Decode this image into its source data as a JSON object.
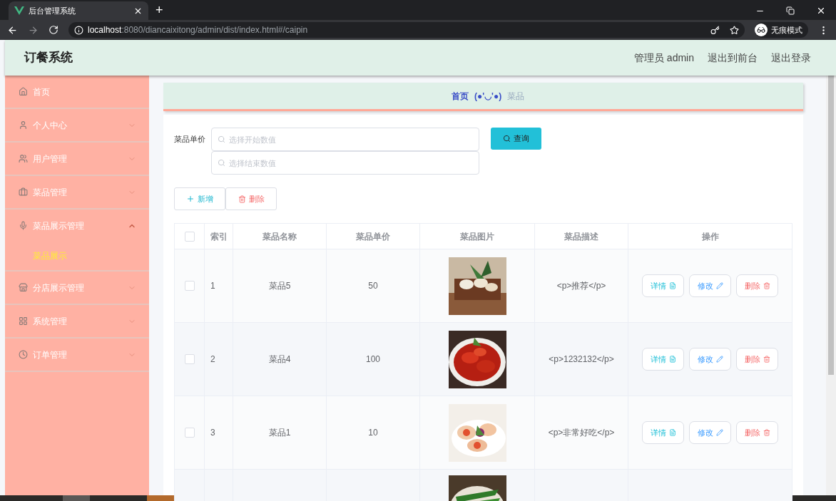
{
  "browser": {
    "tab_title": "后台管理系统",
    "new_tab": "+",
    "url_host": "localhost",
    "url_rest": ":8080/diancaixitong/admin/dist/index.html#/caipin",
    "profile": "无痕模式"
  },
  "header": {
    "title": "订餐系统",
    "links": [
      "管理员 admin",
      "退出到前台",
      "退出登录"
    ]
  },
  "sidebar": {
    "items": [
      {
        "label": "首页",
        "kind": "link"
      },
      {
        "label": "个人中心",
        "kind": "menu",
        "expanded": false
      },
      {
        "label": "用户管理",
        "kind": "menu",
        "expanded": false
      },
      {
        "label": "菜品管理",
        "kind": "menu",
        "expanded": false
      },
      {
        "label": "菜品展示管理",
        "kind": "menu",
        "expanded": true,
        "children": [
          {
            "label": "菜品展示",
            "selected": true
          }
        ]
      },
      {
        "label": "分店展示管理",
        "kind": "menu",
        "expanded": false
      },
      {
        "label": "系统管理",
        "kind": "menu",
        "expanded": false
      },
      {
        "label": "订单管理",
        "kind": "menu",
        "expanded": false
      }
    ]
  },
  "breadcrumb": {
    "home": "首页",
    "separator": "(●'◡'●)",
    "current": "菜品"
  },
  "search": {
    "label": "菜品单价",
    "start_placeholder": "选择开始数值",
    "end_placeholder": "选择结束数值",
    "button": "查询"
  },
  "actions": {
    "add": "新增",
    "delete": "删除"
  },
  "table": {
    "select_all_checked": false,
    "columns": [
      "索引",
      "菜品名称",
      "菜品单价",
      "菜品图片",
      "菜品描述",
      "操作"
    ],
    "rows": [
      {
        "checked": false,
        "index": "1",
        "name": "菜品5",
        "price": "50",
        "description": "<p>推荐</p>",
        "buttons": [
          "详情",
          "修改",
          "删除"
        ]
      },
      {
        "checked": false,
        "index": "2",
        "name": "菜品4",
        "price": "100",
        "description": "<p>1232132</p>",
        "buttons": [
          "详情",
          "修改",
          "删除"
        ]
      },
      {
        "checked": false,
        "index": "3",
        "name": "菜品1",
        "price": "10",
        "description": "<p>非常好吃</p>",
        "buttons": [
          "详情",
          "修改",
          "删除"
        ]
      }
    ]
  }
}
